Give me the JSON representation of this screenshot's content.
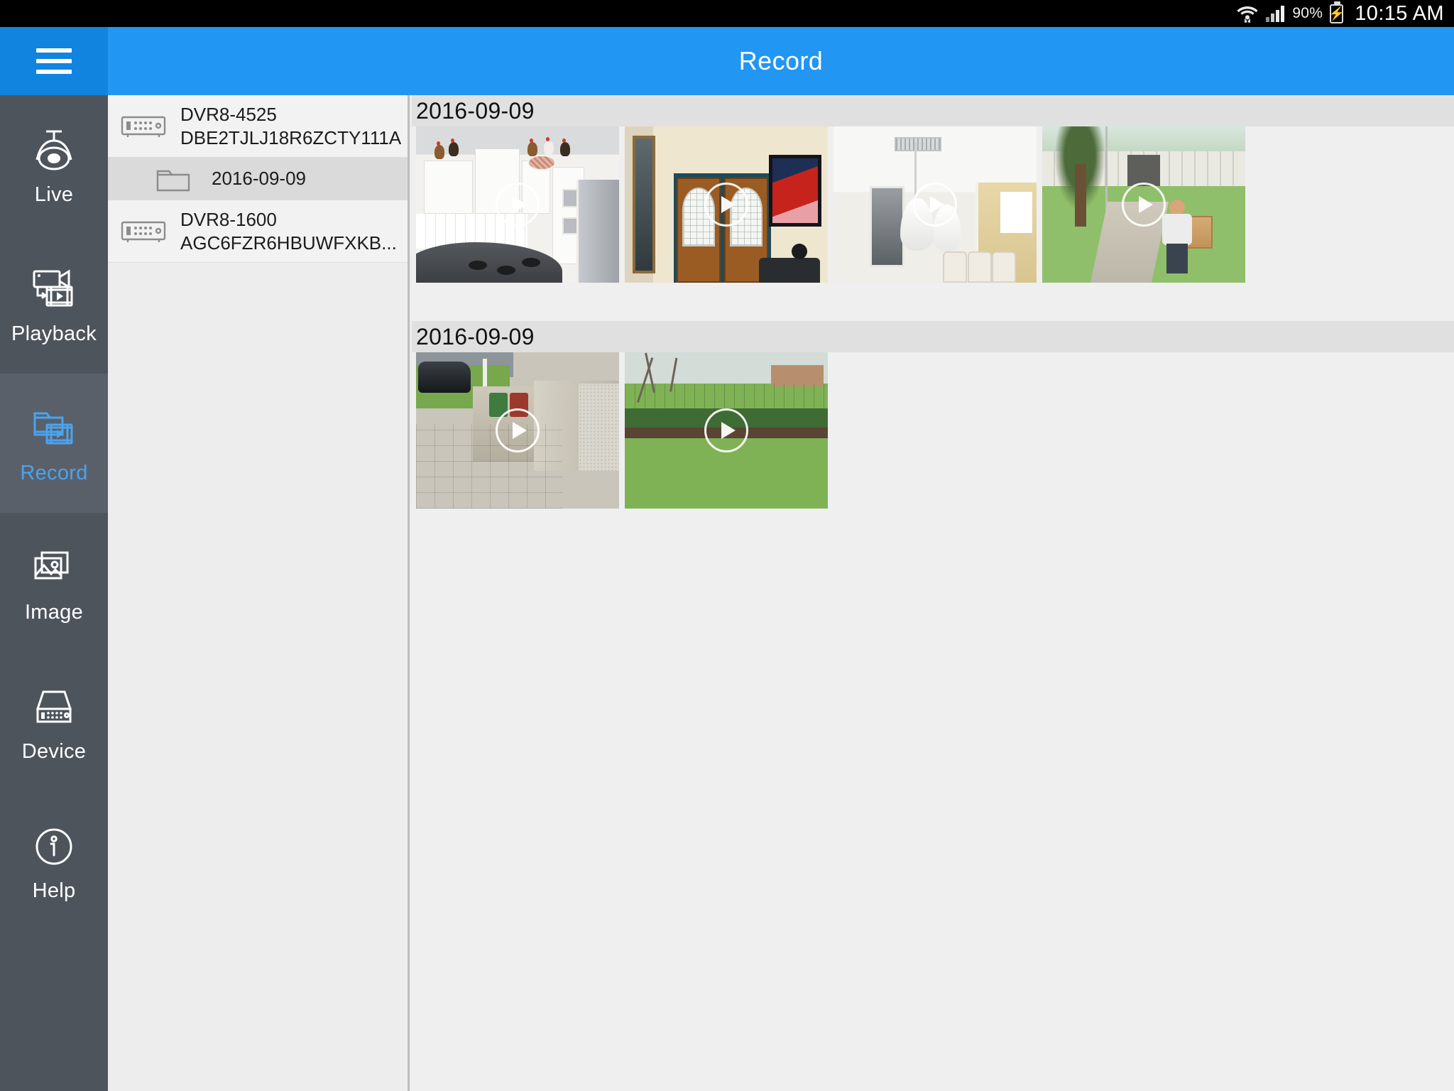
{
  "status_bar": {
    "wifi_icon": "wifi-icon",
    "signal_icon": "cellular-signal-icon",
    "battery_percent": "90%",
    "battery_icon": "battery-charging-icon",
    "time": "10:15 AM"
  },
  "app_bar": {
    "menu_icon": "hamburger-menu-icon",
    "title": "Record"
  },
  "sidebar": {
    "items": [
      {
        "label": "Live",
        "icon": "dome-camera-icon",
        "active": false
      },
      {
        "label": "Playback",
        "icon": "camera-playback-icon",
        "active": false
      },
      {
        "label": "Record",
        "icon": "folder-video-icon",
        "active": true
      },
      {
        "label": "Image",
        "icon": "photo-stack-icon",
        "active": false
      },
      {
        "label": "Device",
        "icon": "dvr-device-icon",
        "active": false
      },
      {
        "label": "Help",
        "icon": "info-circle-icon",
        "active": false
      }
    ]
  },
  "device_tree": [
    {
      "type": "device",
      "icon": "dvr-icon",
      "name": "DVR8-4525",
      "serial": "DBE2TJLJ18R6ZCTY111A",
      "selected": false
    },
    {
      "type": "folder",
      "icon": "folder-icon",
      "label": "2016-09-09",
      "selected": true
    },
    {
      "type": "device",
      "icon": "dvr-icon",
      "name": "DVR8-1600",
      "serial": "AGC6FZR6HBUWFXKB...",
      "selected": false
    }
  ],
  "recordings": {
    "groups": [
      {
        "date": "2016-09-09",
        "items": [
          {
            "scene": "sc-kitchen",
            "alt": "kitchen-with-roosters-thumbnail",
            "play_icon": "play-icon"
          },
          {
            "scene": "sc-door",
            "alt": "front-entry-doors-thumbnail",
            "play_icon": "play-icon"
          },
          {
            "scene": "sc-dining",
            "alt": "dining-room-pendant-lights-thumbnail",
            "play_icon": "play-icon"
          },
          {
            "scene": "sc-yard",
            "alt": "front-yard-delivery-person-thumbnail",
            "play_icon": "play-icon"
          }
        ]
      },
      {
        "date": "2016-09-09",
        "items": [
          {
            "scene": "sc-drive",
            "alt": "driveway-side-patio-thumbnail",
            "play_icon": "play-icon"
          },
          {
            "scene": "sc-lawn",
            "alt": "backyard-lawn-fence-thumbnail",
            "play_icon": "play-icon"
          }
        ]
      }
    ]
  },
  "colors": {
    "appbar": "#2196f3",
    "appbar_menu": "#1184e0",
    "sidebar": "#4e545c",
    "sidebar_active_bg": "#5a6069",
    "sidebar_active_text": "#4aa3f0",
    "content_bg": "#efefef",
    "group_header_bg": "#e0e0e0",
    "tree_bg": "#ededed",
    "tree_selected_bg": "#dadada",
    "statusbar": "#000000"
  }
}
